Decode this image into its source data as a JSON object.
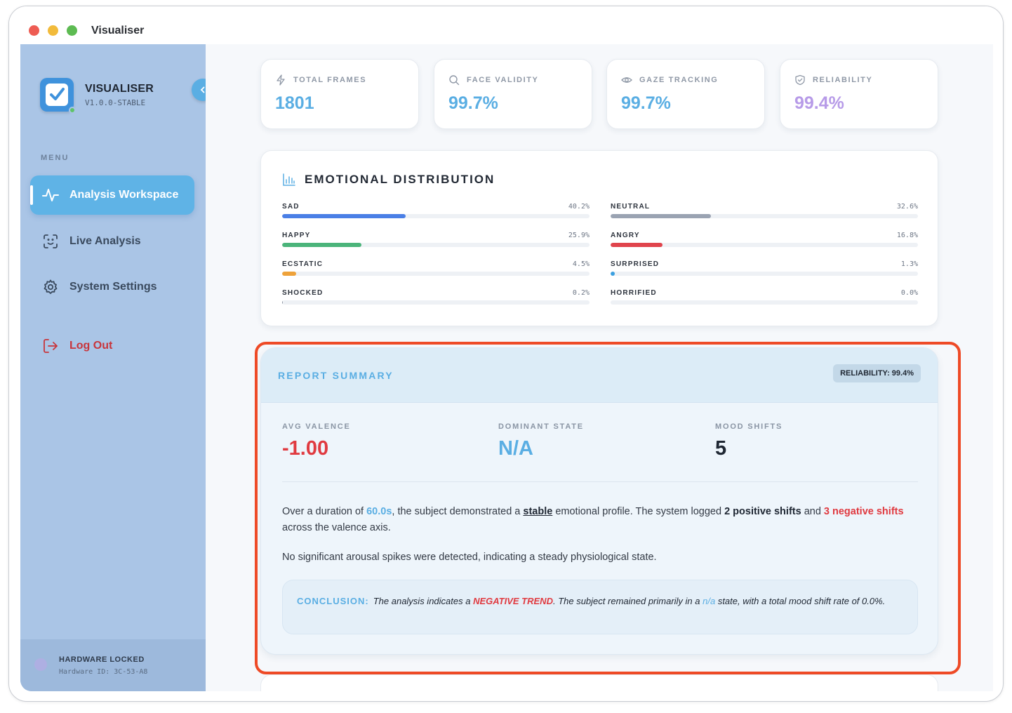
{
  "window": {
    "title": "Visualiser"
  },
  "sidebar": {
    "app_name": "VISUALISER",
    "version": "V1.0.0-STABLE",
    "menu_label": "MENU",
    "items": [
      {
        "label": "Analysis Workspace",
        "icon": "activity-icon",
        "active": true
      },
      {
        "label": "Live Analysis",
        "icon": "face-scan-icon",
        "active": false
      },
      {
        "label": "System Settings",
        "icon": "gear-icon",
        "active": false
      }
    ],
    "logout_label": "Log Out",
    "footer": {
      "title": "HARDWARE LOCKED",
      "hardware_id": "Hardware ID: 3C-53-A8"
    }
  },
  "stats": [
    {
      "label": "TOTAL FRAMES",
      "value": "1801",
      "icon": "lightning-icon",
      "color": "#5aaee3"
    },
    {
      "label": "FACE VALIDITY",
      "value": "99.7%",
      "icon": "search-icon",
      "color": "#5aaee3"
    },
    {
      "label": "GAZE TRACKING",
      "value": "99.7%",
      "icon": "eye-icon",
      "color": "#5aaee3"
    },
    {
      "label": "RELIABILITY",
      "value": "99.4%",
      "icon": "shield-check-icon",
      "color": "#b79be8"
    }
  ],
  "distribution": {
    "title": "EMOTIONAL DISTRIBUTION",
    "emotions": [
      {
        "name": "SAD",
        "pct": "40.2%",
        "value": 40.2,
        "color": "#4a7fe6"
      },
      {
        "name": "NEUTRAL",
        "pct": "32.6%",
        "value": 32.6,
        "color": "#9aa3b2"
      },
      {
        "name": "HAPPY",
        "pct": "25.9%",
        "value": 25.9,
        "color": "#4bb47a"
      },
      {
        "name": "ANGRY",
        "pct": "16.8%",
        "value": 16.8,
        "color": "#e0444c"
      },
      {
        "name": "ECSTATIC",
        "pct": "4.5%",
        "value": 4.5,
        "color": "#eea23a"
      },
      {
        "name": "SURPRISED",
        "pct": "1.3%",
        "value": 1.3,
        "color": "#3a9fe0"
      },
      {
        "name": "SHOCKED",
        "pct": "0.2%",
        "value": 0.2,
        "color": "#8a92a0"
      },
      {
        "name": "HORRIFIED",
        "pct": "0.0%",
        "value": 0.0,
        "color": "#8a92a0"
      }
    ]
  },
  "report": {
    "title": "REPORT SUMMARY",
    "reliability_badge": "RELIABILITY: 99.4%",
    "metrics": [
      {
        "label": "AVG VALENCE",
        "value": "-1.00",
        "color": "#e03a40"
      },
      {
        "label": "DOMINANT STATE",
        "value": "N/A",
        "color": "#5aaee3"
      },
      {
        "label": "MOOD SHIFTS",
        "value": "5",
        "color": "#1f2733"
      }
    ],
    "para1": {
      "t1": "Over a duration of ",
      "duration": "60.0s",
      "t2": ", the subject demonstrated a ",
      "stability": "stable",
      "t3": " emotional profile. The system logged ",
      "positive": "2 positive shifts",
      "t4": " and ",
      "negative": "3 negative shifts",
      "t5": " across the valence axis."
    },
    "para2": "No significant arousal spikes were detected, indicating a steady physiological state.",
    "conclusion": {
      "label": "CONCLUSION:",
      "t1": "The analysis indicates a ",
      "trend": "NEGATIVE TREND",
      "t2": ". The subject remained primarily in a ",
      "state": "n/a",
      "t3": " state, with a total mood shift rate of 0.0%."
    }
  }
}
